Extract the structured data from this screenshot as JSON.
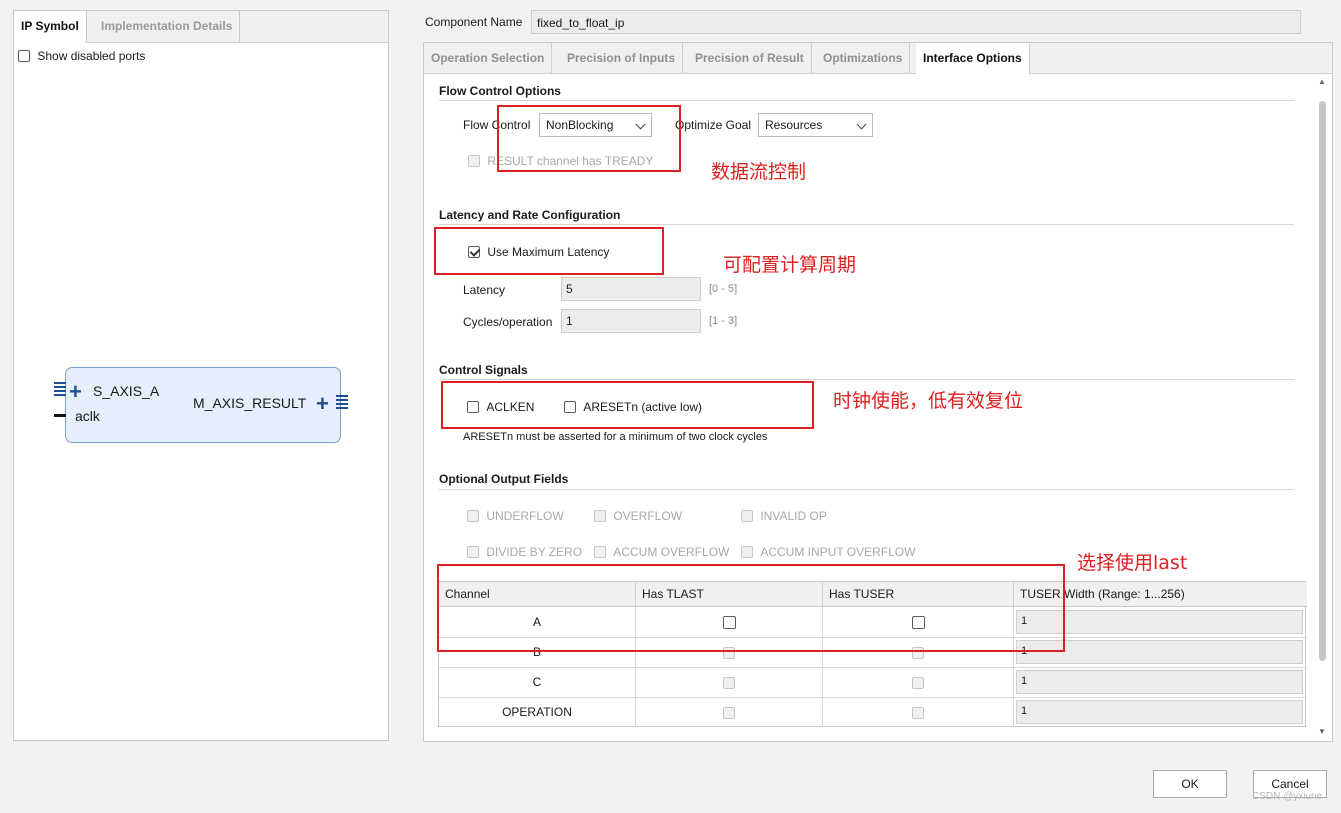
{
  "left": {
    "tabs": [
      "IP Symbol",
      "Implementation Details"
    ],
    "show_disabled_ports": "Show disabled ports",
    "symbol": {
      "port_left": "S_AXIS_A",
      "port_clk": "aclk",
      "port_right": "M_AXIS_RESULT"
    }
  },
  "component": {
    "label": "Component Name",
    "value": "fixed_to_float_ip"
  },
  "right_tabs": [
    "Operation Selection",
    "Precision of Inputs",
    "Precision of Result",
    "Optimizations",
    "Interface Options"
  ],
  "active_tab": "Interface Options",
  "flow": {
    "title": "Flow Control Options",
    "flow_control_label": "Flow Control",
    "flow_control_value": "NonBlocking",
    "optimize_goal_label": "Optimize Goal",
    "optimize_goal_value": "Resources",
    "tready_label": "RESULT channel has TREADY"
  },
  "latency": {
    "title": "Latency and Rate Configuration",
    "use_max_label": "Use Maximum Latency",
    "latency_label": "Latency",
    "latency_value": "5",
    "latency_range": "[0 - 5]",
    "cycles_label": "Cycles/operation",
    "cycles_value": "1",
    "cycles_range": "[1 - 3]"
  },
  "control": {
    "title": "Control Signals",
    "aclken": "ACLKEN",
    "aresetn": "ARESETn (active low)",
    "note": "ARESETn must be asserted for a minimum of two clock cycles"
  },
  "optional": {
    "title": "Optional Output Fields",
    "fields": [
      "UNDERFLOW",
      "OVERFLOW",
      "INVALID OP",
      "DIVIDE BY ZERO",
      "ACCUM OVERFLOW",
      "ACCUM INPUT OVERFLOW"
    ]
  },
  "table": {
    "headers": [
      "Channel",
      "Has TLAST",
      "Has TUSER",
      "TUSER Width (Range: 1...256)"
    ],
    "rows": [
      {
        "channel": "A",
        "width": "1"
      },
      {
        "channel": "B",
        "width": "1"
      },
      {
        "channel": "C",
        "width": "1"
      },
      {
        "channel": "OPERATION",
        "width": "1"
      }
    ]
  },
  "annotations": {
    "flow": "数据流控制",
    "latency": "可配置计算周期",
    "control": "时钟使能，低有效复位",
    "tlast": "选择使用last"
  },
  "buttons": {
    "ok": "OK",
    "cancel": "Cancel"
  },
  "watermark": "CSDN @yxiune",
  "colors": {
    "annotation_red": "#e02020",
    "symbol_fill": "#e6eefb",
    "symbol_border": "#7fa0cc"
  }
}
